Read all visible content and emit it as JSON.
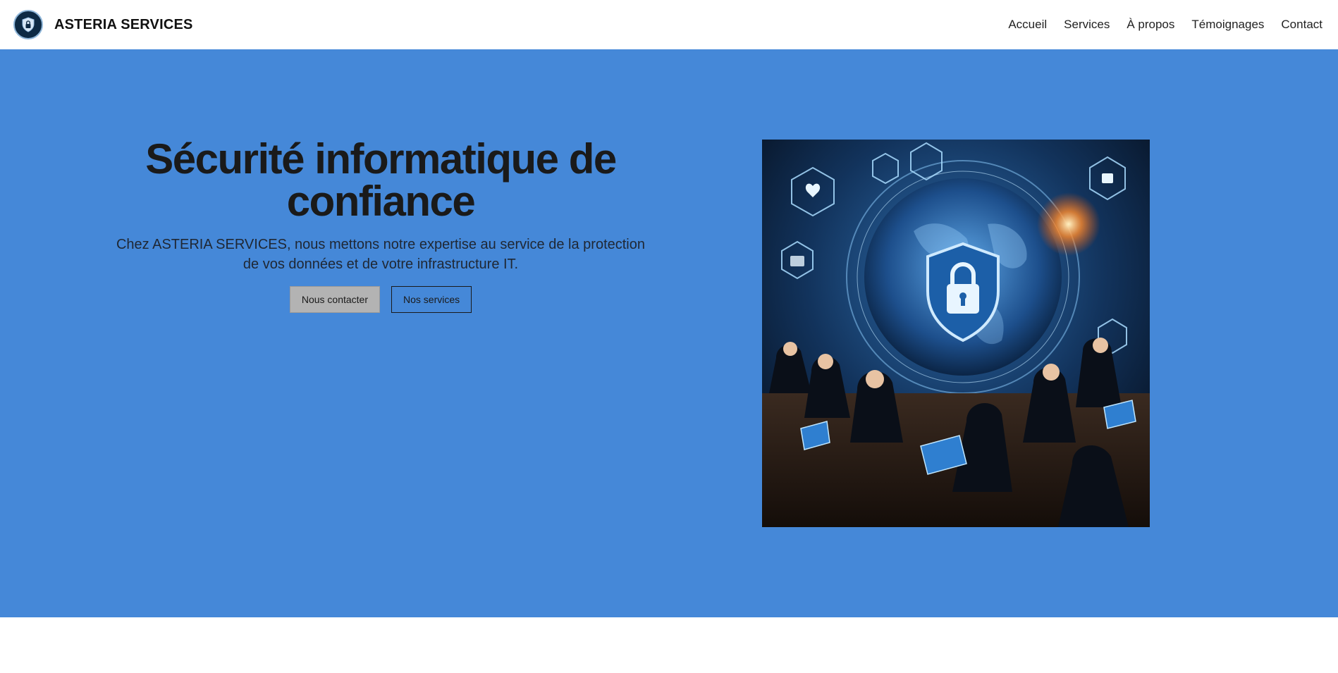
{
  "header": {
    "brand": "ASTERIA SERVICES",
    "nav": [
      "Accueil",
      "Services",
      "À propos",
      "Témoignages",
      "Contact"
    ]
  },
  "hero": {
    "title": "Sécurité informatique de confiance",
    "subtitle": "Chez ASTERIA SERVICES, nous mettons notre expertise au service de la protection de vos données et de votre infrastructure IT.",
    "primary_button": "Nous contacter",
    "secondary_button": "Nos services",
    "image_icon": "cybersecurity-illustration"
  },
  "colors": {
    "hero_background": "#4588d8",
    "header_background": "#ffffff",
    "primary_button": "#b3b3b3"
  }
}
